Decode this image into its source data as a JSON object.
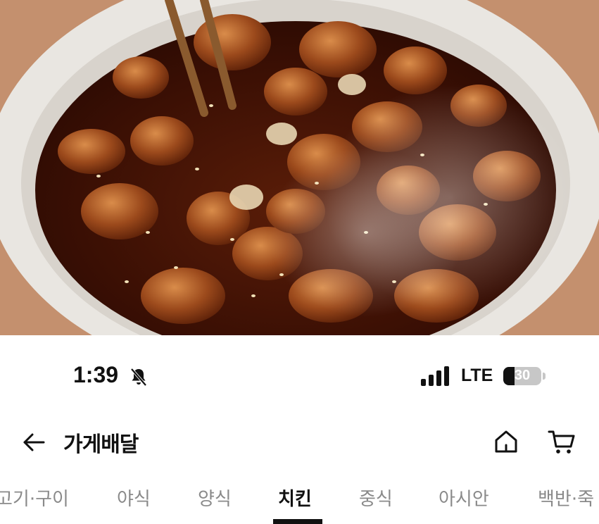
{
  "photo": {
    "description_icon": "food-photo"
  },
  "status_bar": {
    "time": "1:39",
    "network": "LTE",
    "battery": "30",
    "battery_level": 0.3,
    "icons": [
      "silent-bell-icon",
      "signal-bars-icon",
      "battery-icon"
    ]
  },
  "header": {
    "title": "가게배달",
    "icons": [
      "back-arrow-icon",
      "home-icon",
      "cart-icon"
    ]
  },
  "tabs": {
    "items": [
      {
        "label": "고기·구이",
        "active": false
      },
      {
        "label": "야식",
        "active": false
      },
      {
        "label": "양식",
        "active": false
      },
      {
        "label": "치킨",
        "active": true
      },
      {
        "label": "중식",
        "active": false
      },
      {
        "label": "아시안",
        "active": false
      },
      {
        "label": "백반·죽",
        "active": false
      }
    ]
  },
  "colors": {
    "text_primary": "#111111",
    "text_secondary": "#8a8a8a",
    "background": "#ffffff"
  }
}
